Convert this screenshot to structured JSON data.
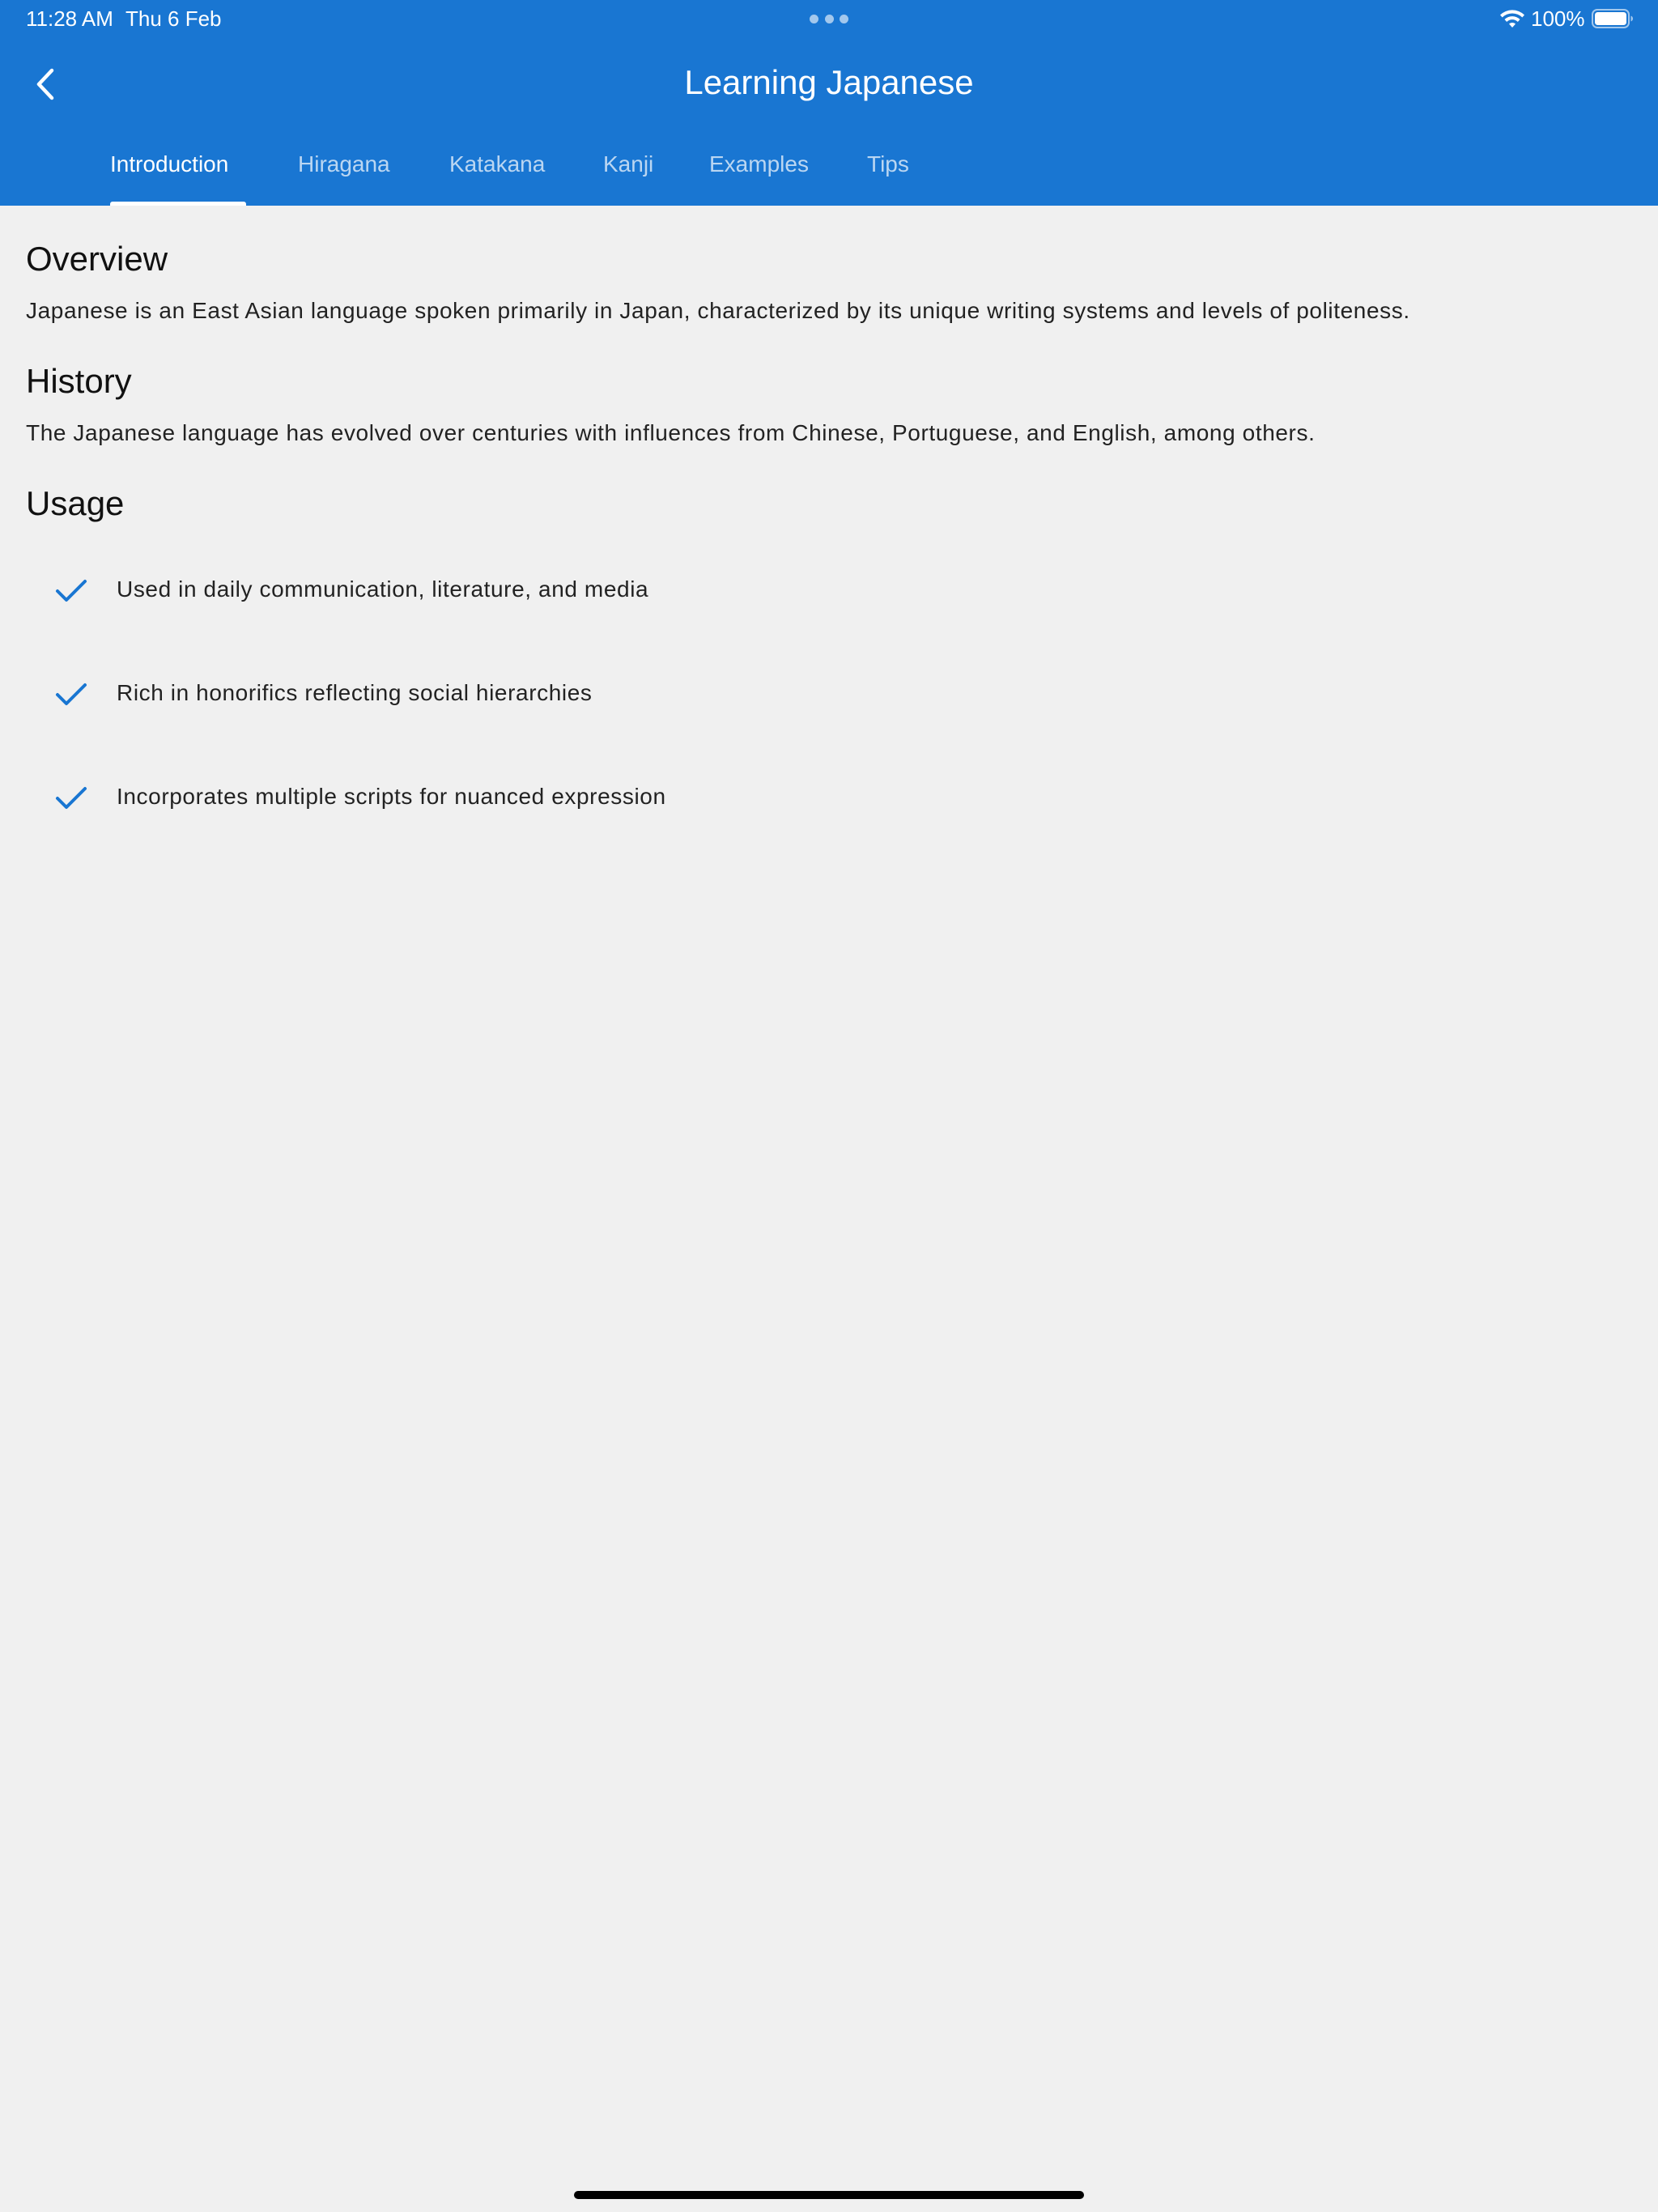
{
  "status_bar": {
    "time": "11:28 AM",
    "date": "Thu 6 Feb",
    "battery": "100%"
  },
  "nav": {
    "title": "Learning Japanese",
    "back_icon": "chevron-left-icon"
  },
  "tabs": [
    {
      "label": "Introduction",
      "active": true
    },
    {
      "label": "Hiragana",
      "active": false
    },
    {
      "label": "Katakana",
      "active": false
    },
    {
      "label": "Kanji",
      "active": false
    },
    {
      "label": "Examples",
      "active": false
    },
    {
      "label": "Tips",
      "active": false
    }
  ],
  "sections": {
    "overview": {
      "title": "Overview",
      "body": "Japanese is an East Asian language spoken primarily in Japan, characterized by its unique writing systems and levels of politeness."
    },
    "history": {
      "title": "History",
      "body": "The Japanese language has evolved over centuries with influences from Chinese, Portuguese, and English, among others."
    },
    "usage": {
      "title": "Usage",
      "items": [
        "Used in daily communication, literature, and media",
        "Rich in honorifics reflecting social hierarchies",
        "Incorporates multiple scripts for nuanced expression"
      ]
    }
  },
  "colors": {
    "primary": "#1976d2",
    "background": "#f0f0f0",
    "check": "#1976d2"
  }
}
